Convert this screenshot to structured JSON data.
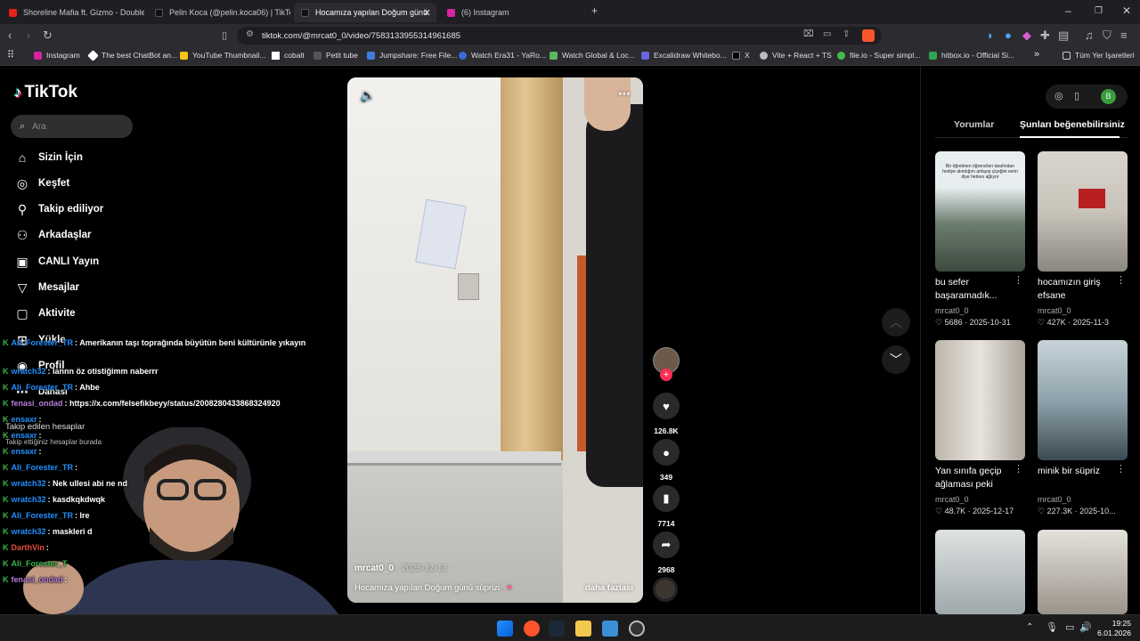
{
  "browser": {
    "tabs": [
      {
        "title": "Shoreline Mafia ft. Gizmo - Double Sh",
        "color": "#e62117"
      },
      {
        "title": "Pelin Koca (@pelin.koca06) | TikTok",
        "color": "#111111"
      },
      {
        "title": "Hocamıza yapılan Doğum günü",
        "color": "#111111"
      },
      {
        "title": "(6) Instagram",
        "color": "#d6249f"
      }
    ],
    "active_tab": 2,
    "url": "tiktok.com/@mrcat0_0/video/7583133955314961685",
    "bookmarks": [
      {
        "label": "Instagram",
        "color": "#d6249f"
      },
      {
        "label": "The best ChatBot an...",
        "color": "#ffffff"
      },
      {
        "label": "YouTube Thumbnail...",
        "color": "#f5c518"
      },
      {
        "label": "cobalt",
        "color": "#ffffff"
      },
      {
        "label": "Petit tube",
        "color": "#333333"
      },
      {
        "label": "Jumpshare: Free File...",
        "color": "#3d7dd8"
      },
      {
        "label": "Watch Era31 - YaRo...",
        "color": "#3a6bd6"
      },
      {
        "label": "Watch Global & Loc...",
        "color": "#5cb85c"
      },
      {
        "label": "Excalidraw Whitebo...",
        "color": "#6965db"
      },
      {
        "label": "X",
        "color": "#000000"
      },
      {
        "label": "Vite + React + TS",
        "color": "#bbbbbb"
      },
      {
        "label": "file.io - Super simpl...",
        "color": "#3fbf4a"
      },
      {
        "label": "hitbox.io - Official Si...",
        "color": "#2ea44f"
      }
    ],
    "all_bookmarks_label": "Tüm Yer İşaretleri",
    "accent": "#fe2c55"
  },
  "tiktok": {
    "logo": "TikTok",
    "search_placeholder": "Ara",
    "nav": [
      {
        "label": "Sizin İçin",
        "icon": "home-icon"
      },
      {
        "label": "Keşfet",
        "icon": "compass-icon"
      },
      {
        "label": "Takip ediliyor",
        "icon": "user-plus-icon"
      },
      {
        "label": "Arkadaşlar",
        "icon": "friends-icon"
      },
      {
        "label": "CANLI Yayın",
        "icon": "live-icon"
      },
      {
        "label": "Mesajlar",
        "icon": "message-icon"
      },
      {
        "label": "Aktivite",
        "icon": "activity-icon"
      },
      {
        "label": "Yükle",
        "icon": "upload-icon"
      },
      {
        "label": "Profil",
        "icon": "profile-icon"
      },
      {
        "label": "Dahası",
        "icon": "more-icon"
      }
    ],
    "following_heading": "Takip edilen hesaplar",
    "following_hint": "Takip ettiğiniz hesaplar burada",
    "video": {
      "author": "mrcat0_0",
      "date": "2025-12-13",
      "caption": "Hocamıza yapılan Doğum günü süprizi",
      "more": "daha fazlası",
      "likes": "126.8K",
      "comments": "349",
      "saves": "7714",
      "shares": "2968"
    },
    "right_tabs": [
      "Yorumlar",
      "Şunları beğenebilirsiniz"
    ],
    "suggestions": [
      {
        "title": "bu sefer başaramadık...",
        "user": "mrcat0_0",
        "likes": "5686",
        "date": "2025-10-31"
      },
      {
        "title": "hocamızın giriş efsane",
        "user": "mrcat0_0",
        "likes": "427K",
        "date": "2025-11-3"
      },
      {
        "title": "Yan sınıfa geçip ağlaması peki",
        "user": "mrcat0_0",
        "likes": "48.7K",
        "date": "2025-12-17"
      },
      {
        "title": "minik bir süpriz",
        "user": "mrcat0_0",
        "likes": "227.3K",
        "date": "2025-10..."
      }
    ],
    "thumb1_text": "Bir öğretmen öğrencileri tarafından hediye alındığını anlayıp çiçeğini verin diye herkes ağlıyor"
  },
  "chat": [
    {
      "user": "Ali_Forester_TR",
      "msg": ": Amerikanın taşı toprağında büyütün beni kültürünle yıkayın",
      "color": "#1e90ff"
    },
    {
      "user": "wratch32",
      "msg": ": lannn öz otistiğimm naberrr",
      "color": "#1e90ff"
    },
    {
      "user": "Ali_Forester_TR",
      "msg": ": Ahbe",
      "color": "#1e90ff"
    },
    {
      "user": "fenasi_ondad",
      "msg": ": https://x.com/felsefikbeyy/status/2008280433868324920",
      "color": "#9b59b6"
    },
    {
      "user": "ensaxr",
      "msg": ":",
      "color": "#1e90ff"
    },
    {
      "user": "ensaxr",
      "msg": ":",
      "color": "#1e90ff"
    },
    {
      "user": "ensaxr",
      "msg": ":",
      "color": "#1e90ff"
    },
    {
      "user": "Ali_Forester_TR",
      "msg": ":",
      "color": "#1e90ff"
    },
    {
      "user": "wratch32",
      "msg": ": Nek ullesi abi ne nd",
      "color": "#1e90ff"
    },
    {
      "user": "wratch32",
      "msg": ": kasdkqkdwqk",
      "color": "#1e90ff"
    },
    {
      "user": "Ali_Forester_TR",
      "msg": ": Ire",
      "color": "#1e90ff"
    },
    {
      "user": "wratch32",
      "msg": ": maskleri d",
      "color": "#1e90ff"
    },
    {
      "user": "DarthVin",
      "msg": ":",
      "color": "#e74c3c"
    },
    {
      "user": "Ali_Forester_T",
      "msg": "",
      "color": "#1e90ff"
    },
    {
      "user": "fenasi_ondad",
      "msg": ":",
      "color": "#9b59b6"
    }
  ],
  "system": {
    "time": "19:25",
    "date": "6.01.2026"
  }
}
